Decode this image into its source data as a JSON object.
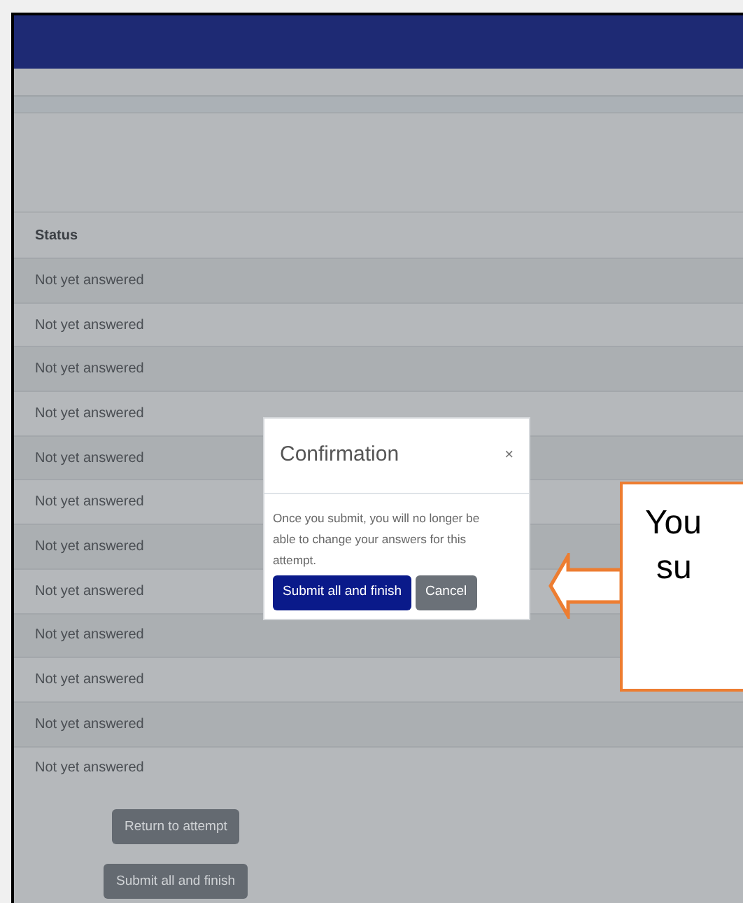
{
  "table": {
    "columns": [
      "Status"
    ],
    "rows": [
      "Not yet answered",
      "Not yet answered",
      "Not yet answered",
      "Not yet answered",
      "Not yet answered",
      "Not yet answered",
      "Not yet answered",
      "Not yet answered",
      "Not yet answered",
      "Not yet answered",
      "Not yet answered",
      "Not yet answered"
    ]
  },
  "buttons": [
    "Return to attempt",
    "Submit all and finish"
  ],
  "dialog": {
    "title": "Confirmation",
    "close": "×",
    "message": "Once you submit, you will no longer be able to change your answers for this attempt.",
    "buttons": [
      {
        "label": "Submit all and finish",
        "kind": "primary"
      },
      {
        "label": "Cancel",
        "kind": "secondary"
      }
    ]
  },
  "callout": {
    "lines": [
      "You",
      "su"
    ]
  }
}
